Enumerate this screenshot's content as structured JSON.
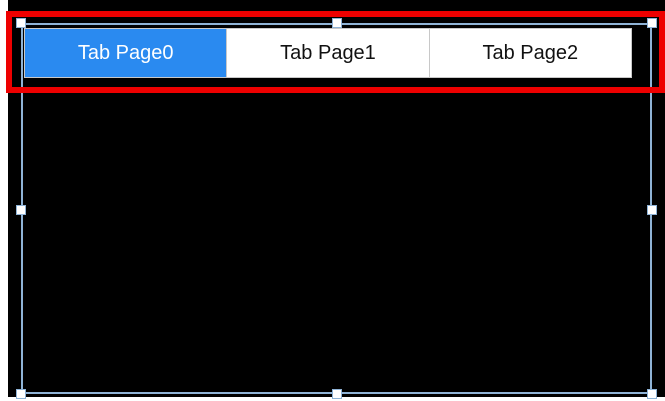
{
  "tab_control": {
    "tabs": [
      {
        "label": "Tab Page0",
        "active": true
      },
      {
        "label": "Tab Page1",
        "active": false
      },
      {
        "label": "Tab Page2",
        "active": false
      }
    ]
  },
  "colors": {
    "active_tab": "#2a8af0",
    "highlight": "#ee0000",
    "selection_frame": "#8fb3d6",
    "canvas": "#000000"
  }
}
